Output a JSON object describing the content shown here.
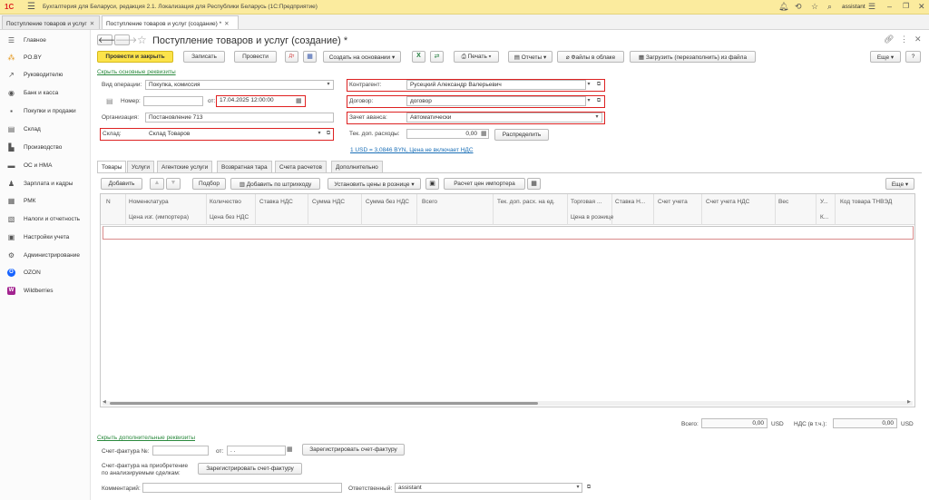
{
  "app": {
    "title": "Бухгалтерия для Беларуси, редакция 2.1. Локализация для Республики Беларусь  (1С:Предприятие)",
    "user": "assistant"
  },
  "window_tabs": [
    {
      "label": "Поступление товаров и услуг"
    },
    {
      "label": "Поступление товаров и услуг (создание) *"
    }
  ],
  "sidebar": {
    "items": [
      {
        "label": "Главное",
        "icon": "☰"
      },
      {
        "label": "PO.BY",
        "icon": "⁂"
      },
      {
        "label": "Руководителю",
        "icon": "↗"
      },
      {
        "label": "Банк и касса",
        "icon": "◉"
      },
      {
        "label": "Покупки и продажи",
        "icon": "▪"
      },
      {
        "label": "Склад",
        "icon": "▤"
      },
      {
        "label": "Производство",
        "icon": "▙"
      },
      {
        "label": "ОС и НМА",
        "icon": "▬"
      },
      {
        "label": "Зарплата и кадры",
        "icon": "♟"
      },
      {
        "label": "РМК",
        "icon": "▦"
      },
      {
        "label": "Налоги и отчетность",
        "icon": "▧"
      },
      {
        "label": "Настройки учета",
        "icon": "▣"
      },
      {
        "label": "Администрирование",
        "icon": "⚙"
      },
      {
        "label": "OZON",
        "icon": "O"
      },
      {
        "label": "Wildberries",
        "icon": "W"
      }
    ]
  },
  "form": {
    "title": "Поступление товаров и услуг (создание) *",
    "more_label": "Еще",
    "help_label": "?",
    "toolbar": {
      "post_close": "Провести и закрыть",
      "save": "Записать",
      "post": "Провести",
      "create_based": "Создать на основании",
      "print": "Печать",
      "reports": "Отчеты",
      "cloud_files": "Файлы в облаке",
      "load_file": "Загрузить (перезаполнить) из файла"
    },
    "hide_main_link": "Скрыть основные реквизиты",
    "fields": {
      "op_type_label": "Вид операции:",
      "op_type_value": "Покупка, комиссия",
      "number_label": "Номер:",
      "number_value": "",
      "date_label": "от:",
      "date_value": "17.04.2025 12:00:00",
      "org_label": "Организация:",
      "org_value": "Постановление 713",
      "warehouse_label": "Склад:",
      "warehouse_value": "Склад Товаров",
      "counterparty_label": "Контрагент:",
      "counterparty_value": "Русецкий Александр Валерьевич",
      "contract_label": "Договор:",
      "contract_value": "договор",
      "advance_label": "Зачет аванса:",
      "advance_value": "Автоматически",
      "extra_cost_label": "Тек. доп. расходы:",
      "extra_cost_value": "0,00",
      "distribute_label": "Распределить",
      "rate_link": "1 USD = 3,0846 BYN, Цена не включает НДС"
    },
    "tabs": [
      {
        "label": "Товары"
      },
      {
        "label": "Услуги"
      },
      {
        "label": "Агентские услуги"
      },
      {
        "label": "Возвратная тара"
      },
      {
        "label": "Счета расчетов"
      },
      {
        "label": "Дополнительно"
      }
    ],
    "table_toolbar": {
      "add": "Добавить",
      "pick": "Подбор",
      "barcode": "Добавить по штрихкоду",
      "retail_prices": "Установить цены в рознице",
      "importer_calc": "Расчет цен импортера",
      "more": "Еще"
    },
    "table": {
      "headers_row1": [
        "N",
        "Номенклатура",
        "Количество",
        "Ставка НДС",
        "Сумма НДС",
        "Сумма без НДС",
        "Всего",
        "Тек. доп. расх. на ед.",
        "Торговая ...",
        "Ставка Н...",
        "Счет учета",
        "Счет учета НДС",
        "Вес",
        "У...",
        "Код товара ТНВЭД"
      ],
      "headers_row2": [
        "Цена изг. (импортера)",
        "Цена без НДС",
        "Цена в рознице",
        "К..."
      ]
    },
    "totals": {
      "total_label": "Всего:",
      "total_value": "0,00",
      "total_currency": "USD",
      "vat_label": "НДС (в т.ч.):",
      "vat_value": "0,00",
      "vat_currency": "USD"
    },
    "hide_extra_link": "Скрыть дополнительные реквизиты",
    "invoice": {
      "label": "Счет-фактура №:",
      "number_value": "",
      "date_label": "от:",
      "date_value": "  .  .",
      "register_label": "Зарегистрировать счет-фактуру",
      "analyzed_label_1": "Счет-фактура на приобретение",
      "analyzed_label_2": "по анализируемым сделкам:",
      "analyzed_register_label": "Зарегистрировать счет-фактуру"
    },
    "comment_label": "Комментарий:",
    "comment_value": "",
    "responsible_label": "Ответственный:",
    "responsible_value": "assistant"
  },
  "colors": {
    "accent": "#fce34a",
    "highlight": "#e02020",
    "link": "#1a6fb7"
  }
}
